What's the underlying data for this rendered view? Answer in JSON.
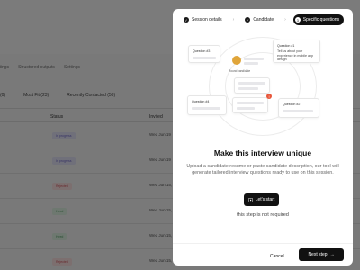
{
  "background": {
    "tabs": [
      "Settings",
      "Structured outputs",
      "Settings"
    ],
    "filters": [
      "(0)",
      "Most Fit (23)",
      "Recently Contacted (56)"
    ],
    "table": {
      "headers": [
        "Status",
        "Invited"
      ],
      "rows": [
        {
          "status": "In progress",
          "status_type": "progress",
          "invited": "Wed Jun 19"
        },
        {
          "status": "In progress",
          "status_type": "progress",
          "invited": "Wed Jun 19"
        },
        {
          "status": "Rejected",
          "status_type": "rejected",
          "invited": "Wed Jun 15, 2"
        },
        {
          "status": "Hired",
          "status_type": "hired",
          "invited": "Wed Jun 15, 2"
        },
        {
          "status": "Hired",
          "status_type": "hired",
          "invited": "Wed Jun 15, 2"
        },
        {
          "status": "Rejected",
          "status_type": "rejected",
          "invited": "Wed Jun 15, 2"
        }
      ]
    }
  },
  "modal": {
    "steps": [
      {
        "label": "Session details",
        "icon": "check-icon",
        "state": "done"
      },
      {
        "label": "Candidate",
        "icon": "check-icon",
        "state": "done"
      },
      {
        "label": "Specific questions",
        "number": "3",
        "state": "active"
      }
    ],
    "illustration": {
      "q3": "Question #3",
      "q1_title": "Question #1",
      "q1_text": "Tell us about your experience in mobile app design",
      "avatar_label": "Round candidate",
      "q4": "Question #4",
      "q2": "Question #2"
    },
    "title": "Make this interview unique",
    "description": "Upload a candidate resume or paste candidate description, our tool will generate tailored interview questions ready to use on this session.",
    "start_label": "Let's start",
    "not_required": "this step is not required",
    "cancel_label": "Cancel",
    "next_label": "Next step",
    "next_icon": "arrow-right-icon"
  }
}
